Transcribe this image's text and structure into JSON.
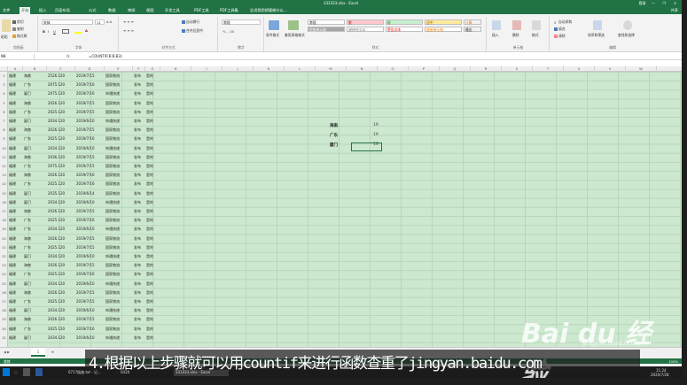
{
  "window": {
    "title": "333333.xlsx - Excel",
    "user": "登录",
    "controls": [
      "—",
      "❐",
      "✕"
    ]
  },
  "tabs": [
    "文件",
    "开始",
    "插入",
    "页面布局",
    "公式",
    "数据",
    "审阅",
    "视图",
    "开发工具",
    "PDF工具",
    "PDF工具集",
    "告诉我您想要做什么..."
  ],
  "tabs_right": "共享",
  "ribbon": {
    "clipboard": {
      "cut": "剪切",
      "copy": "复制",
      "painter": "格式刷",
      "paste": "粘贴",
      "label": "剪贴板"
    },
    "font": {
      "name": "宋体",
      "size": "11",
      "label": "字体"
    },
    "align": {
      "wrap": "自动换行",
      "merge": "合并后居中",
      "label": "对齐方式"
    },
    "number": {
      "format": "常规",
      "label": "数字"
    },
    "styles": {
      "cond": "条件格式",
      "table": "套用表格格式",
      "cells": [
        "常规",
        "差",
        "好",
        "适中",
        "计算",
        "检查单元格",
        "解释性文本",
        "警告文本",
        "链接单元格",
        "输出"
      ],
      "label": "样式"
    },
    "cells": {
      "insert": "插入",
      "delete": "删除",
      "format": "格式",
      "label": "单元格"
    },
    "editing": {
      "autosum": "自动求和",
      "fill": "填充",
      "clear": "清除",
      "sort": "排序和筛选",
      "find": "查找和选择",
      "label": "编辑"
    }
  },
  "formula_bar": {
    "name_box": "N8",
    "fx": "fx",
    "formula": "=COUNTIF(B:B,B3)"
  },
  "columns": [
    "A",
    "B",
    "C",
    "D",
    "E",
    "F",
    "G",
    "H",
    "I",
    "J",
    "K",
    "L",
    "M",
    "N",
    "O",
    "P",
    "Q",
    "R",
    "S",
    "T",
    "U",
    "V",
    "W"
  ],
  "rows": [
    [
      "福建",
      "海南",
      "2526.120",
      "2019/7/15",
      "国家物流",
      "发布",
      "是的"
    ],
    [
      "福建",
      "广东",
      "2075.120",
      "2019/7/16",
      "国家物流",
      "发布",
      "是的"
    ],
    [
      "福建",
      "厦门",
      "2075.120",
      "2019/7/16",
      "申通快递",
      "发布",
      "是的"
    ],
    [
      "福建",
      "海南",
      "2026.120",
      "2019/7/15",
      "国家物流",
      "发布",
      "是的"
    ],
    [
      "福建",
      "广东",
      "2025.120",
      "2019/7/15",
      "国家物流",
      "发布",
      "是的"
    ],
    [
      "福建",
      "厦门",
      "2034.120",
      "2019/6/10",
      "申通快递",
      "发布",
      "是的"
    ],
    [
      "福建",
      "海南",
      "2026.120",
      "2019/7/15",
      "国家物流",
      "发布",
      "是的"
    ],
    [
      "福建",
      "广东",
      "2025.120",
      "2019/7/16",
      "国家物流",
      "发布",
      "是的"
    ],
    [
      "福建",
      "厦门",
      "2034.120",
      "2019/6/10",
      "申通快递",
      "发布",
      "是的"
    ],
    [
      "福建",
      "海南",
      "2036.120",
      "2019/7/15",
      "国家物流",
      "发布",
      "是的"
    ],
    [
      "福建",
      "广东",
      "2075.120",
      "2019/7/15",
      "国家物流",
      "发布",
      "是的"
    ],
    [
      "福建",
      "海南",
      "2026.120",
      "2019/7/16",
      "国家物流",
      "发布",
      "是的"
    ],
    [
      "福建",
      "广东",
      "2025.120",
      "2019/7/16",
      "国家物流",
      "发布",
      "是的"
    ],
    [
      "福建",
      "厦门",
      "2035.120",
      "2019/6/14",
      "国家物流",
      "发布",
      "是的"
    ],
    [
      "福建",
      "厦门",
      "2034.120",
      "2019/6/10",
      "申通快递",
      "发布",
      "是的"
    ],
    [
      "福建",
      "海南",
      "2026.120",
      "2019/7/15",
      "国家物流",
      "发布",
      "是的"
    ],
    [
      "福建",
      "广东",
      "2025.120",
      "2019/7/16",
      "国家物流",
      "发布",
      "是的"
    ],
    [
      "福建",
      "广东",
      "2034.120",
      "2019/6/10",
      "申通快递",
      "发布",
      "是的"
    ],
    [
      "福建",
      "海南",
      "2026.120",
      "2019/7/15",
      "国家物流",
      "发布",
      "是的"
    ],
    [
      "福建",
      "广东",
      "2025.120",
      "2019/7/15",
      "国家物流",
      "发布",
      "是的"
    ],
    [
      "福建",
      "厦门",
      "2034.120",
      "2019/6/10",
      "申通快递",
      "发布",
      "是的"
    ],
    [
      "福建",
      "海南",
      "2026.120",
      "2019/7/15",
      "国家物流",
      "发布",
      "是的"
    ],
    [
      "福建",
      "广东",
      "2025.120",
      "2019/7/16",
      "国家物流",
      "发布",
      "是的"
    ],
    [
      "福建",
      "厦门",
      "2034.120",
      "2019/6/10",
      "申通快递",
      "发布",
      "是的"
    ],
    [
      "福建",
      "海南",
      "2026.120",
      "2019/7/15",
      "国家物流",
      "发布",
      "是的"
    ],
    [
      "福建",
      "广东",
      "2025.120",
      "2019/7/15",
      "国家物流",
      "发布",
      "是的"
    ],
    [
      "福建",
      "厦门",
      "2034.120",
      "2019/6/10",
      "申通快递",
      "发布",
      "是的"
    ],
    [
      "福建",
      "海南",
      "2026.120",
      "2019/7/15",
      "国家物流",
      "发布",
      "是的"
    ],
    [
      "福建",
      "广东",
      "2025.120",
      "2019/7/16",
      "国家物流",
      "发布",
      "是的"
    ],
    [
      "福建",
      "厦门",
      "2034.120",
      "2019/6/10",
      "申通快递",
      "发布",
      "是的"
    ]
  ],
  "row_numbers": [
    "2",
    "3",
    "4",
    "5",
    "6",
    "7",
    "8",
    "9",
    "10",
    "11",
    "12",
    "13",
    "14",
    "15",
    "16",
    "17",
    "18",
    "19",
    "20",
    "21",
    "22",
    "23",
    "24",
    "25",
    "26",
    "27",
    "28",
    "29",
    "30",
    "31"
  ],
  "results": [
    {
      "label": "海南",
      "value": "19"
    },
    {
      "label": "广东",
      "value": "19"
    },
    {
      "label": "厦门",
      "value": "19"
    }
  ],
  "sheet_tab": "1",
  "status": {
    "left": "就绪",
    "zoom": "100%"
  },
  "taskbar": {
    "items": [
      "0717插曲.txt - 记...",
      "0420",
      "333333.xlsx - Excel"
    ],
    "time": "11:24",
    "date": "2020/7/28"
  },
  "caption": "4.根据以上步骤就可以用countif来进行函数查重了jingyan.baidu.com",
  "watermark": {
    "logo": "Bai du 经验",
    "url": "jingyan.baidu.com"
  }
}
